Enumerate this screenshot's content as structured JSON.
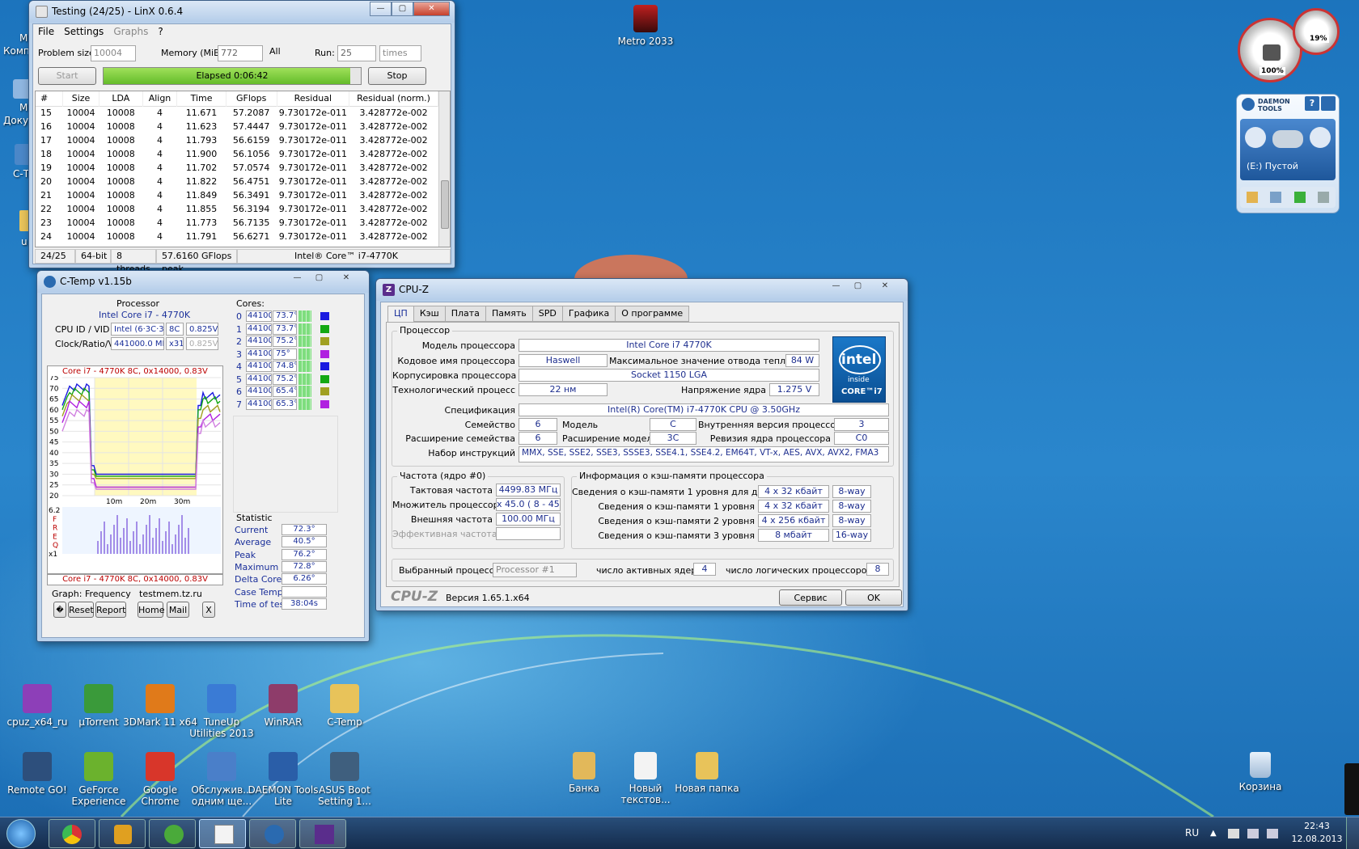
{
  "desktop": {
    "top_icon": "Metro 2033",
    "left_partial": [
      "М",
      "Комп",
      "М",
      "Доку",
      "C-Т",
      "u"
    ],
    "row1": [
      {
        "label": "cpuz_x64_ru",
        "color": "#8d3fb8"
      },
      {
        "label": "µTorrent",
        "color": "#3a9a3a"
      },
      {
        "label": "3DMark 11 x64",
        "color": "#e07a1a"
      },
      {
        "label": "TuneUp Utilities 2013",
        "color": "#3a7bd5"
      },
      {
        "label": "WinRAR",
        "color": "#8e3c6a"
      },
      {
        "label": "C-Temp",
        "color": "#e8c35a"
      }
    ],
    "row2": [
      {
        "label": "Remote GO!",
        "color": "#2d4f7c"
      },
      {
        "label": "GeForce Experience",
        "color": "#6bb22d"
      },
      {
        "label": "Google Chrome",
        "color": "#d8362a"
      },
      {
        "label": "Обслужив... одним ще...",
        "color": "#4a7fc9"
      },
      {
        "label": "DAEMON Tools Lite",
        "color": "#2a5ea8"
      },
      {
        "label": "ASUS Boot Setting 1...",
        "color": "#3f5f7e"
      }
    ],
    "mid": [
      {
        "label": "Банка",
        "color": "#e2b85a"
      },
      {
        "label": "Новый текстов...",
        "color": "#f3f3f3"
      },
      {
        "label": "Новая папка",
        "color": "#e8c35a"
      }
    ],
    "recycle": "Корзина"
  },
  "linx": {
    "title": "Testing (24/25) - LinX 0.6.4",
    "menu": [
      "File",
      "Settings",
      "Graphs",
      "?"
    ],
    "problem_label": "Problem size:",
    "problem_value": "10004",
    "memory_label": "Memory (MiB):",
    "memory_value": "772",
    "all_label": "All",
    "run_label": "Run:",
    "run_value": "25",
    "times_value": "times",
    "start": "Start",
    "elapsed": "Elapsed 0:06:42",
    "stop": "Stop",
    "progress": 0.96,
    "columns": [
      "#",
      "Size",
      "LDA",
      "Align",
      "Time",
      "GFlops",
      "Residual",
      "Residual (norm.)"
    ],
    "rows": [
      [
        "15",
        "10004",
        "10008",
        "4",
        "11.671",
        "57.2087",
        "9.730172e-011",
        "3.428772e-002"
      ],
      [
        "16",
        "10004",
        "10008",
        "4",
        "11.623",
        "57.4447",
        "9.730172e-011",
        "3.428772e-002"
      ],
      [
        "17",
        "10004",
        "10008",
        "4",
        "11.793",
        "56.6159",
        "9.730172e-011",
        "3.428772e-002"
      ],
      [
        "18",
        "10004",
        "10008",
        "4",
        "11.900",
        "56.1056",
        "9.730172e-011",
        "3.428772e-002"
      ],
      [
        "19",
        "10004",
        "10008",
        "4",
        "11.702",
        "57.0574",
        "9.730172e-011",
        "3.428772e-002"
      ],
      [
        "20",
        "10004",
        "10008",
        "4",
        "11.822",
        "56.4751",
        "9.730172e-011",
        "3.428772e-002"
      ],
      [
        "21",
        "10004",
        "10008",
        "4",
        "11.849",
        "56.3491",
        "9.730172e-011",
        "3.428772e-002"
      ],
      [
        "22",
        "10004",
        "10008",
        "4",
        "11.855",
        "56.3194",
        "9.730172e-011",
        "3.428772e-002"
      ],
      [
        "23",
        "10004",
        "10008",
        "4",
        "11.773",
        "56.7135",
        "9.730172e-011",
        "3.428772e-002"
      ],
      [
        "24",
        "10004",
        "10008",
        "4",
        "11.791",
        "56.6271",
        "9.730172e-011",
        "3.428772e-002"
      ]
    ],
    "status": [
      "24/25",
      "64-bit",
      "8 threads",
      "57.6160 GFlops peak",
      "Intel® Core™ i7-4770K"
    ]
  },
  "ctemp": {
    "title": "C-Temp v1.15b",
    "processor_label": "Processor",
    "cpu_name": "Intel Core i7 - 4770K",
    "cpuid_label": "CPU ID  / VID",
    "cpuid_value": "Intel (6·3C·3)",
    "cpuid_8c": "8C",
    "vid": "0.825V",
    "clock_label": "Clock/Ratio/V",
    "clock_value": "441000.0 MHz",
    "ratio": "x31.5",
    "volt": "0.825V",
    "graph_title": "Core i7 - 4770K 8C, 0x14000, 0.83V",
    "graph_footer": "Core i7 - 4770K 8C, 0x14000, 0.83V",
    "y_ticks": [
      "75",
      "70",
      "65",
      "60",
      "55",
      "50",
      "45",
      "40",
      "35",
      "30",
      "25",
      "20"
    ],
    "x_ticks": [
      "10m",
      "20m",
      "30m"
    ],
    "freq_labels": [
      "6.2",
      "F",
      "R",
      "E",
      "Q",
      "x1"
    ],
    "cores_label": "Cores:",
    "cores": [
      {
        "n": "0",
        "f": "441000",
        "t": "73.7°",
        "c": "#1a1ae0"
      },
      {
        "n": "1",
        "f": "441000",
        "t": "73.7°",
        "c": "#13a813"
      },
      {
        "n": "2",
        "f": "441000",
        "t": "75.2°",
        "c": "#a0a020"
      },
      {
        "n": "3",
        "f": "441000",
        "t": "75°",
        "c": "#b020e0"
      },
      {
        "n": "4",
        "f": "441000",
        "t": "74.8°",
        "c": "#1a1ae0"
      },
      {
        "n": "5",
        "f": "441000",
        "t": "75.2°",
        "c": "#13a813"
      },
      {
        "n": "6",
        "f": "441000",
        "t": "65.4°",
        "c": "#a0a020"
      },
      {
        "n": "7",
        "f": "441000",
        "t": "65.3°",
        "c": "#b020e0"
      }
    ],
    "stat_title": "Statistic",
    "stats": [
      {
        "k": "Current",
        "v": "72.3°"
      },
      {
        "k": "Average",
        "v": "40.5°"
      },
      {
        "k": "Peak",
        "v": "76.2°"
      },
      {
        "k": "Maximum",
        "v": "72.8°"
      },
      {
        "k": "Delta Cores",
        "v": "6.26°"
      },
      {
        "k": "Case Temp",
        "v": ""
      },
      {
        "k": "Time of test",
        "v": "38:04s"
      }
    ],
    "graph_freq_label": "Graph: Frequency",
    "site": "testmem.tz.ru",
    "btn_q": "�",
    "btn_reset": "Reset",
    "btn_report": "Report",
    "btn_home": "Home",
    "btn_mail": "Mail",
    "btn_x": "X"
  },
  "cpuz": {
    "title": "CPU-Z",
    "tabs": [
      "ЦП",
      "Кэш",
      "Плата",
      "Память",
      "SPD",
      "Графика",
      "О программе"
    ],
    "proc_group": "Процессор",
    "model_label": "Модель процессора",
    "model": "Intel Core i7 4770K",
    "code_label": "Кодовое имя процессора",
    "code": "Haswell",
    "tdp_label": "Максимальное значение отвода тепла",
    "tdp": "84 W",
    "pkg_label": "Корпусировка процессора",
    "pkg": "Socket 1150 LGA",
    "tech_label": "Технологический процесс",
    "tech": "22 нм",
    "vcore_label": "Напряжение ядра",
    "vcore": "1.275 V",
    "spec_label": "Спецификация",
    "spec": "Intel(R) Core(TM) i7-4770K CPU @ 3.50GHz",
    "family_label": "Семейство",
    "family": "6",
    "model2_label": "Модель",
    "model2": "C",
    "step_label": "Внутренняя версия процессора",
    "step": "3",
    "extfam_label": "Расширение семейства",
    "extfam": "6",
    "extmod_label": "Расширение модели",
    "extmod": "3C",
    "rev_label": "Ревизия ядра процессора",
    "rev": "C0",
    "instr_label": "Набор инструкций",
    "instr": "MMX, SSE, SSE2, SSE3, SSSE3, SSE4.1, SSE4.2, EM64T, VT-x, AES, AVX, AVX2, FMA3",
    "logo": {
      "brand": "intel",
      "inside": "inside",
      "core": "CORE™i7"
    },
    "clk_group": "Частота (ядро #0)",
    "core_speed_label": "Тактовая частота",
    "core_speed": "4499.83 МГц",
    "mult_label": "Множитель процессора",
    "mult": "x 45.0 ( 8 - 45 )",
    "bus_label": "Внешняя частота",
    "bus": "100.00 МГц",
    "rated_label": "Эффективная частота",
    "rated": "",
    "cache_group": "Информация о кэш-памяти процессора",
    "cache": [
      {
        "k": "Сведения о кэш-памяти 1 уровня для данных",
        "v": "4 x 32 кбайт",
        "w": "8-way"
      },
      {
        "k": "Сведения о кэш-памяти 1 уровня",
        "v": "4 x 32 кбайт",
        "w": "8-way"
      },
      {
        "k": "Сведения о кэш-памяти 2 уровня",
        "v": "4 x 256 кбайт",
        "w": "8-way"
      },
      {
        "k": "Сведения о кэш-памяти 3 уровня",
        "v": "8 мбайт",
        "w": "16-way"
      }
    ],
    "sel_label": "Выбранный процессор:",
    "sel_value": "Processor #1",
    "cores_label": "число активных ядер",
    "cores": "4",
    "threads_label": "число логических процессоров",
    "threads": "8",
    "brand": "CPU-Z",
    "version": "Версия 1.65.1.x64",
    "service": "Сервис",
    "ok": "OK"
  },
  "daemon": {
    "title": "DAEMON TOOLS",
    "drive": "(E:) Пустой",
    "help": "?"
  },
  "gauges": {
    "cpu": "100%",
    "mem": "19%"
  },
  "taskbar": {
    "lang": "RU",
    "time": "22:43",
    "date": "12.08.2013"
  }
}
